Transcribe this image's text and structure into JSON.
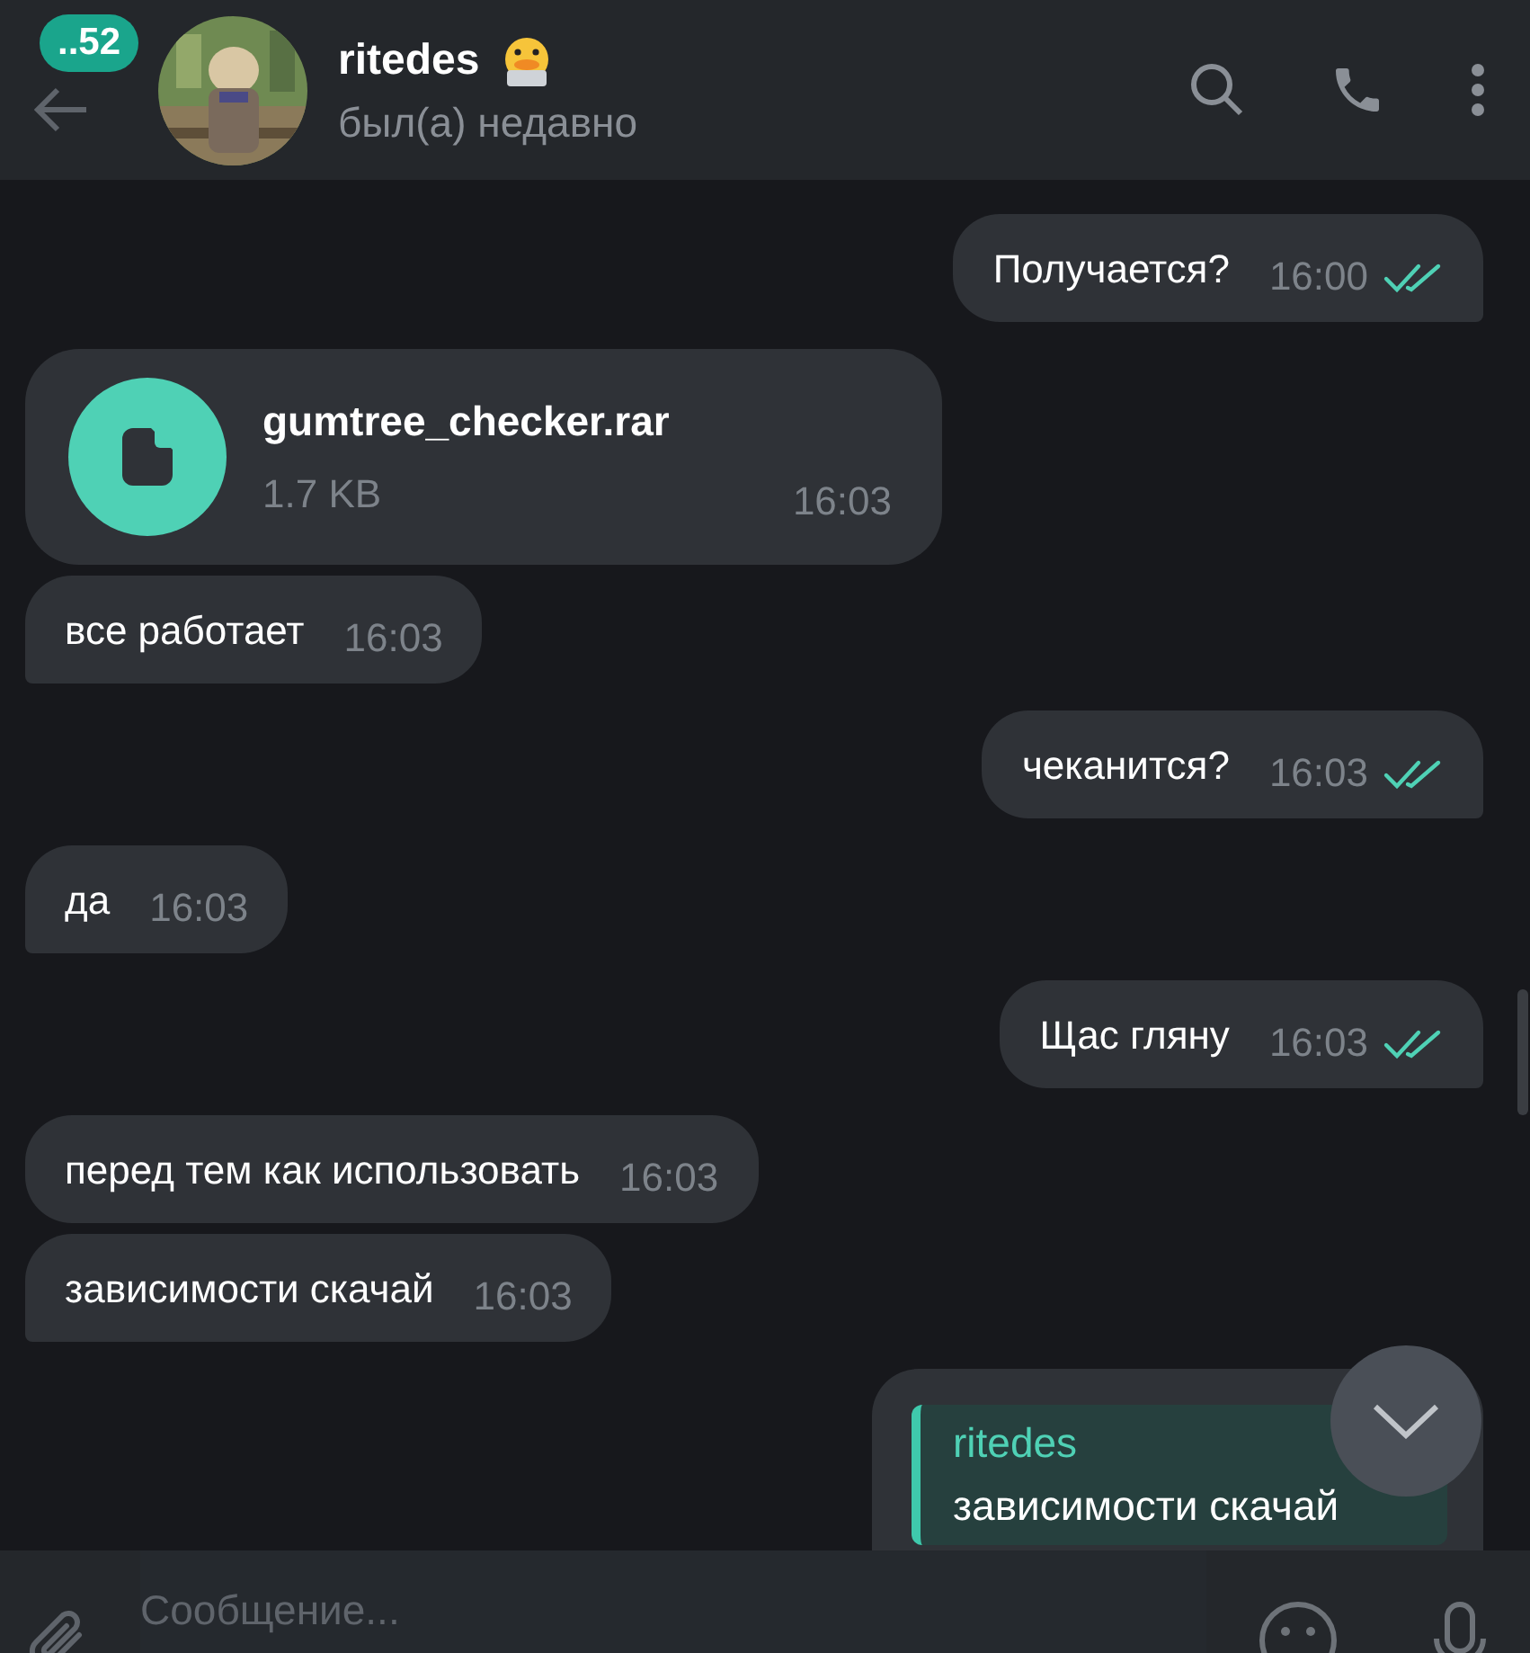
{
  "header": {
    "unread_badge": "..52",
    "title": "ritedes",
    "status": "был(а) недавно"
  },
  "messages": [
    {
      "kind": "text",
      "outgoing": true,
      "text": "Получается?",
      "time": "16:00",
      "read": true,
      "tail": true
    },
    {
      "kind": "file",
      "outgoing": false,
      "file_name": "gumtree_checker.rar",
      "file_size": "1.7 KB",
      "time": "16:03",
      "tail": false
    },
    {
      "kind": "text",
      "outgoing": false,
      "text": "все работает",
      "time": "16:03",
      "tail": true
    },
    {
      "kind": "text",
      "outgoing": true,
      "text": "чеканится?",
      "time": "16:03",
      "read": true,
      "tail": true
    },
    {
      "kind": "text",
      "outgoing": false,
      "text": "да",
      "time": "16:03",
      "tail": true
    },
    {
      "kind": "text",
      "outgoing": true,
      "text": "Щас гляну",
      "time": "16:03",
      "read": true,
      "tail": true
    },
    {
      "kind": "text",
      "outgoing": false,
      "text": "перед тем как использовать",
      "time": "16:03",
      "tail": false
    },
    {
      "kind": "text",
      "outgoing": false,
      "text": "зависимости скачай",
      "time": "16:03",
      "tail": true
    },
    {
      "kind": "reply",
      "outgoing": true,
      "reply_author": "ritedes",
      "reply_text": "зависимости скачай"
    }
  ],
  "composer": {
    "placeholder": "Сообщение..."
  }
}
